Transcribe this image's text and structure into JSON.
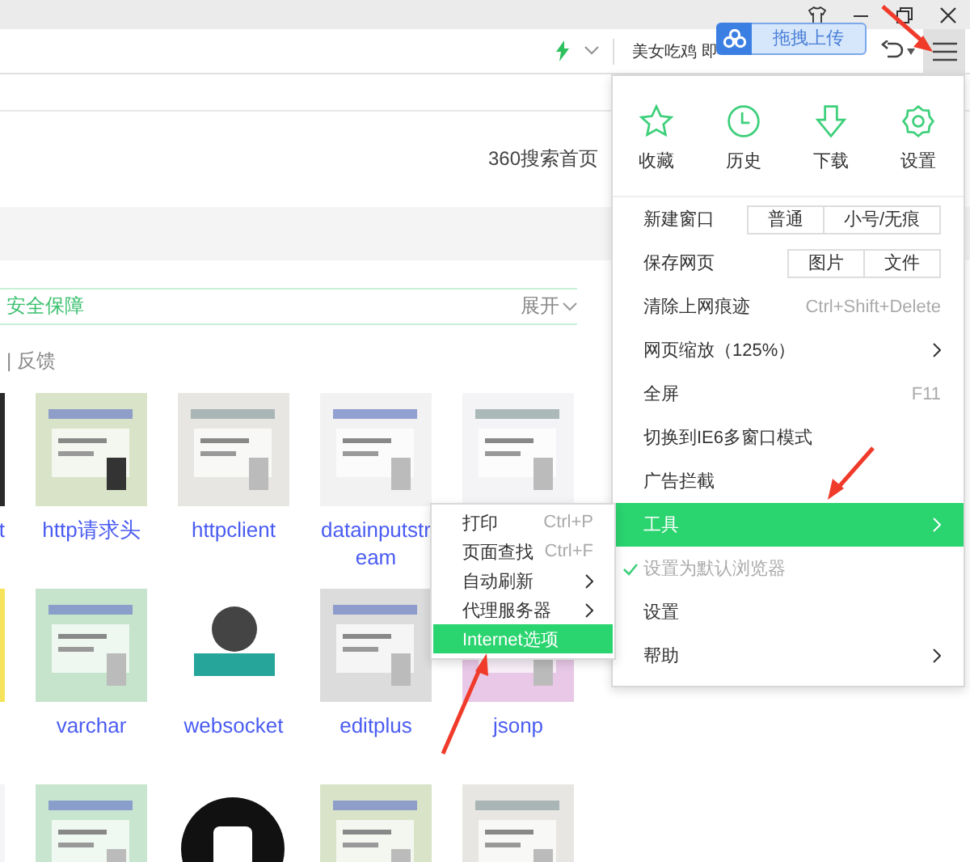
{
  "toolbar": {
    "search_text": "美女吃鸡 即",
    "upload_badge": "拖拽上传"
  },
  "page": {
    "title": "360搜索首页",
    "section": "安全保障",
    "expand": "展开",
    "feedback": "| 反馈",
    "grid": [
      [
        {
          "kind": "picture",
          "label": "t"
        },
        {
          "kind": "picture",
          "label": "http请求头"
        },
        {
          "kind": "picture",
          "label": "httpclient"
        },
        {
          "kind": "picture",
          "label": "datainputstream"
        },
        {
          "kind": "picture"
        }
      ],
      [
        {
          "kind": "picture"
        },
        {
          "kind": "picture",
          "label": "varchar"
        },
        {
          "kind": "picture",
          "label": "websocket"
        },
        {
          "kind": "picture",
          "label": "editplus"
        },
        {
          "kind": "picture",
          "label": "jsonp"
        }
      ],
      [
        {
          "kind": "picture"
        },
        {
          "kind": "picture"
        },
        {
          "kind": "picture"
        },
        {
          "kind": "picture"
        },
        {
          "kind": "picture"
        }
      ]
    ]
  },
  "menu": {
    "quick": [
      {
        "label": "收藏"
      },
      {
        "label": "历史"
      },
      {
        "label": "下载"
      },
      {
        "label": "设置"
      }
    ],
    "items": [
      {
        "label": "新建窗口",
        "buttons": [
          "普通",
          "小号/无痕"
        ],
        "submenu": false,
        "highlighted": false,
        "checked": false
      },
      {
        "label": "保存网页",
        "buttons": [
          "图片",
          "文件"
        ],
        "submenu": false,
        "highlighted": false,
        "checked": false
      },
      {
        "label": "清除上网痕迹",
        "shortcut": "Ctrl+Shift+Delete",
        "submenu": false,
        "highlighted": false,
        "checked": false
      },
      {
        "label": "网页缩放（125%）",
        "submenu": true,
        "highlighted": false,
        "checked": false
      },
      {
        "label": "全屏",
        "shortcut": "F11",
        "submenu": false,
        "highlighted": false,
        "checked": false
      },
      {
        "label": "切换到IE6多窗口模式",
        "submenu": false,
        "highlighted": false,
        "checked": false
      },
      {
        "label": "广告拦截",
        "submenu": false,
        "highlighted": false,
        "checked": false
      },
      {
        "label": "工具",
        "submenu": true,
        "highlighted": true,
        "checked": false
      },
      {
        "label": "设置为默认浏览器",
        "submenu": false,
        "highlighted": false,
        "checked": true
      },
      {
        "label": "设置",
        "submenu": false,
        "highlighted": false,
        "checked": false
      },
      {
        "label": "帮助",
        "submenu": true,
        "highlighted": false,
        "checked": false
      }
    ]
  },
  "submenu": {
    "items": [
      {
        "label": "打印",
        "shortcut": "Ctrl+P",
        "submenu": false,
        "highlighted": false
      },
      {
        "label": "页面查找",
        "shortcut": "Ctrl+F",
        "submenu": false,
        "highlighted": false
      },
      {
        "label": "自动刷新",
        "submenu": true,
        "highlighted": false
      },
      {
        "label": "代理服务器",
        "submenu": true,
        "highlighted": false
      },
      {
        "label": "Internet选项",
        "submenu": false,
        "highlighted": true
      }
    ]
  }
}
